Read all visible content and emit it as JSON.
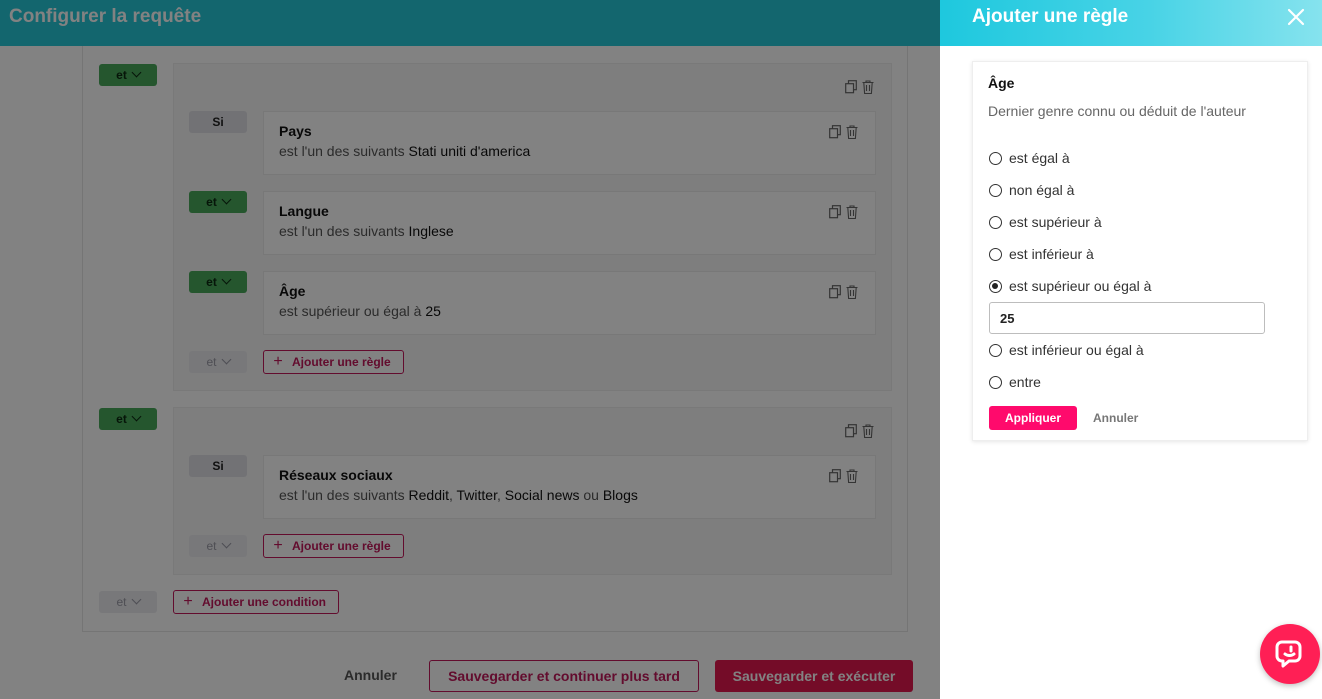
{
  "left_panel": {
    "title": "Configurer la requête",
    "groups": [
      {
        "connector": "et",
        "rules": [
          {
            "connector": "Si",
            "title": "Pays",
            "prefix": "est l'un des suivants",
            "value": "Stati uniti d'america"
          },
          {
            "connector": "et",
            "title": "Langue",
            "prefix": "est l'un des suivants",
            "value": "Inglese"
          },
          {
            "connector": "et",
            "title": "Âge",
            "prefix": "est supérieur ou égal à",
            "value": "25"
          }
        ],
        "trailing_connector": "et",
        "add_rule_label": "Ajouter une règle"
      },
      {
        "connector": "et",
        "rules": [
          {
            "connector": "Si",
            "title": "Réseaux sociaux",
            "prefix": "est l'un des suivants",
            "values": [
              "Reddit",
              ", ",
              "Twitter",
              ", ",
              "Social news",
              " ou ",
              "Blogs"
            ]
          }
        ],
        "trailing_connector": "et",
        "add_rule_label": "Ajouter une règle"
      }
    ],
    "trailing_connector": "et",
    "add_condition_label": "Ajouter une condition",
    "footer": {
      "cancel_label": "Annuler",
      "save_later_label": "Sauvegarder et continuer plus tard",
      "save_run_label": "Sauvegarder et exécuter"
    }
  },
  "right_panel": {
    "title": "Ajouter une règle",
    "rule": {
      "title": "Âge",
      "description": "Dernier genre connu ou déduit de l'auteur",
      "options": [
        {
          "label": "est égal à",
          "checked": false
        },
        {
          "label": "non égal à",
          "checked": false
        },
        {
          "label": "est supérieur à",
          "checked": false
        },
        {
          "label": "est inférieur à",
          "checked": false
        },
        {
          "label": "est supérieur ou égal à",
          "checked": true
        },
        {
          "label": "est inférieur ou égal à",
          "checked": false
        },
        {
          "label": "entre",
          "checked": false
        }
      ],
      "input_value": "25",
      "apply_label": "Appliquer",
      "cancel_label": "Annuler"
    }
  },
  "icons": {
    "close": "close-icon",
    "copy": "copy-icon",
    "trash": "trash-icon",
    "chevron": "chevron-down-icon",
    "plus": "plus-icon",
    "chat": "chat-icon"
  },
  "colors": {
    "header_cyan": "#27c8d8",
    "accent_pink": "#ff0a6c",
    "connector_green": "#49a95a",
    "outline_crimson": "#c2185b"
  }
}
